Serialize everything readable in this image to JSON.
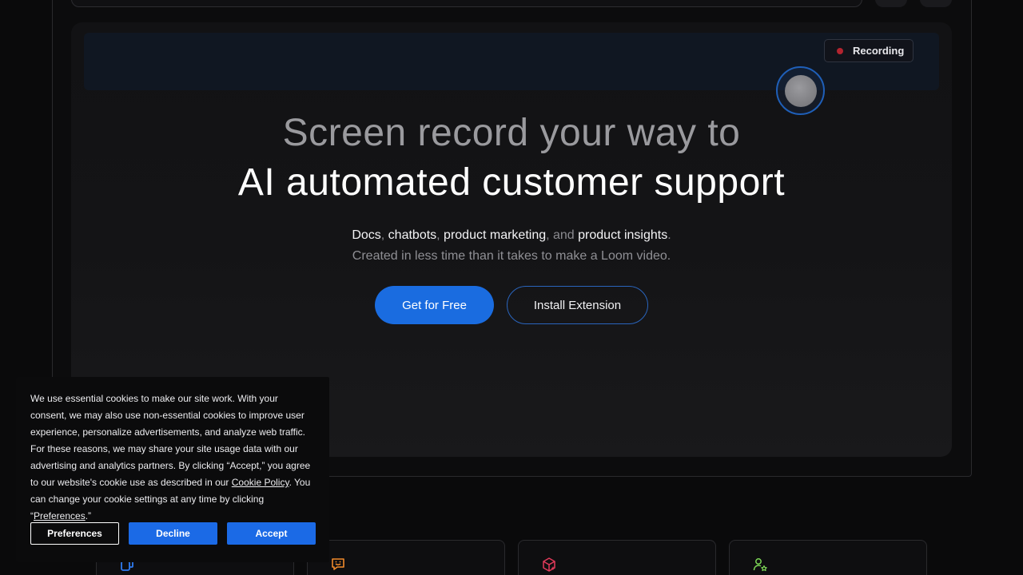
{
  "recording_badge": {
    "label": "Recording"
  },
  "hero": {
    "headline_line1": "Screen record your way to",
    "headline_line2": "AI automated customer support",
    "subline": {
      "parts": [
        "Docs",
        ", ",
        "chatbots",
        ", ",
        "product marketing",
        ", and ",
        "product insights",
        "."
      ]
    },
    "subline2": "Created in less time than it takes to make a Loom video.",
    "primary_cta": "Get for Free",
    "secondary_cta": "Install Extension"
  },
  "cookie_banner": {
    "text_before_link": "We use essential cookies to make our site work. With your consent, we may also use non-essential cookies to improve user experience, personalize advertisements, and analyze web traffic. For these reasons, we may share your site usage data with our advertising and analytics partners. By clicking “Accept,” you agree to our website's cookie use as described in our ",
    "cookie_policy_link": "Cookie Policy",
    "text_middle": ". You can change your cookie settings at any time by clicking “",
    "preferences_link": "Preferences",
    "text_end": ".”",
    "preferences_button": "Preferences",
    "decline_button": "Decline",
    "accept_button": "Accept"
  },
  "feature_cards": [
    {
      "icon": "docs-copy-icon",
      "color": "#2f7bf0"
    },
    {
      "icon": "chat-bubble-icon",
      "color": "#f08a2b"
    },
    {
      "icon": "product-box-sparkle-icon",
      "color": "#e23a5a"
    },
    {
      "icon": "user-star-icon",
      "color": "#7ed957"
    }
  ],
  "colors": {
    "accent_blue": "#1a6ce0",
    "recording_red": "#b3242f"
  }
}
